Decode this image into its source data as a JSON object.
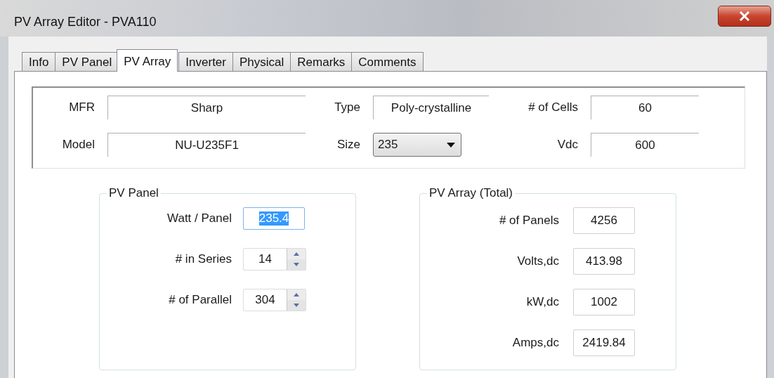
{
  "window": {
    "title": "PV Array Editor - PVA110"
  },
  "tabs": [
    {
      "label": "Info",
      "selected": false
    },
    {
      "label": "PV Panel",
      "selected": false
    },
    {
      "label": "PV Array",
      "selected": true
    },
    {
      "label": "Inverter",
      "selected": false
    },
    {
      "label": "Physical",
      "selected": false
    },
    {
      "label": "Remarks",
      "selected": false
    },
    {
      "label": "Comments",
      "selected": false
    }
  ],
  "module": {
    "fields": [
      {
        "label": "MFR",
        "value": "Sharp",
        "kind": "text"
      },
      {
        "label": "Type",
        "value": "Poly-crystalline",
        "kind": "text"
      },
      {
        "label": "# of Cells",
        "value": "60",
        "kind": "text"
      },
      {
        "label": "Model",
        "value": "NU-U235F1",
        "kind": "text"
      },
      {
        "label": "Size",
        "value": "235",
        "kind": "dropdown"
      },
      {
        "label": "Vdc",
        "value": "600",
        "kind": "text"
      }
    ]
  },
  "pv_panel": {
    "title": "PV Panel",
    "fields": [
      {
        "label": "Watt / Panel",
        "value": "235.4",
        "kind": "text",
        "text_selected": true
      },
      {
        "label": "# in Series",
        "value": "14",
        "kind": "spinner",
        "text_selected": false
      },
      {
        "label": "# of Parallel",
        "value": "304",
        "kind": "spinner",
        "text_selected": false
      }
    ]
  },
  "pv_array_total": {
    "title": "PV Array (Total)",
    "fields": [
      {
        "label": "# of Panels",
        "value": "4256"
      },
      {
        "label": "Volts,dc",
        "value": "413.98"
      },
      {
        "label": "kW,dc",
        "value": "1002"
      },
      {
        "label": "Amps,dc",
        "value": "2419.84"
      }
    ]
  }
}
